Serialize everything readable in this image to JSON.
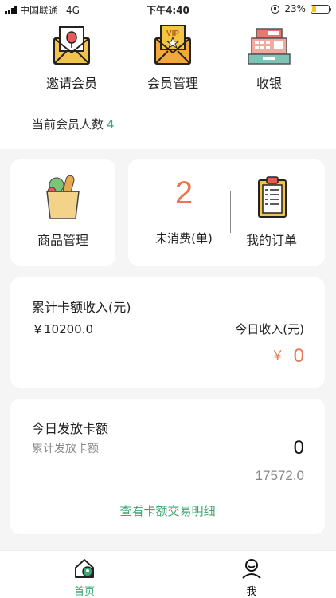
{
  "status_bar": {
    "carrier": "中国联通",
    "network": "4G",
    "time": "下午4:40",
    "battery": "23%",
    "battery_level": 0.23
  },
  "quick_actions": [
    {
      "label": "邀请会员",
      "icon": "invitation-envelope-icon"
    },
    {
      "label": "会员管理",
      "icon": "vip-envelope-icon"
    },
    {
      "label": "收银",
      "icon": "cash-register-icon"
    }
  ],
  "member_count": {
    "label": "当前会员人数",
    "value": "4"
  },
  "goods": {
    "label": "商品管理",
    "icon": "grocery-bag-icon"
  },
  "orders": {
    "unpaid_count": "2",
    "unpaid_label": "未消费(单)",
    "my_orders_label": "我的订单",
    "icon": "clipboard-icon"
  },
  "income": {
    "title": "累计卡额收入(元)",
    "total": "￥10200.0",
    "today_label": "今日收入(元)",
    "today_currency": "￥",
    "today_value": "0"
  },
  "issued": {
    "title": "今日发放卡额",
    "subtitle": "累计发放卡额",
    "today_value": "0",
    "total_value": "17572.0",
    "detail_link": "查看卡额交易明细"
  },
  "bottom_nav": [
    {
      "label": "首页",
      "icon": "home-icon",
      "active": true
    },
    {
      "label": "我",
      "icon": "user-icon",
      "active": false
    }
  ],
  "colors": {
    "accent_green": "#3ba672",
    "accent_orange": "#e8784f"
  }
}
